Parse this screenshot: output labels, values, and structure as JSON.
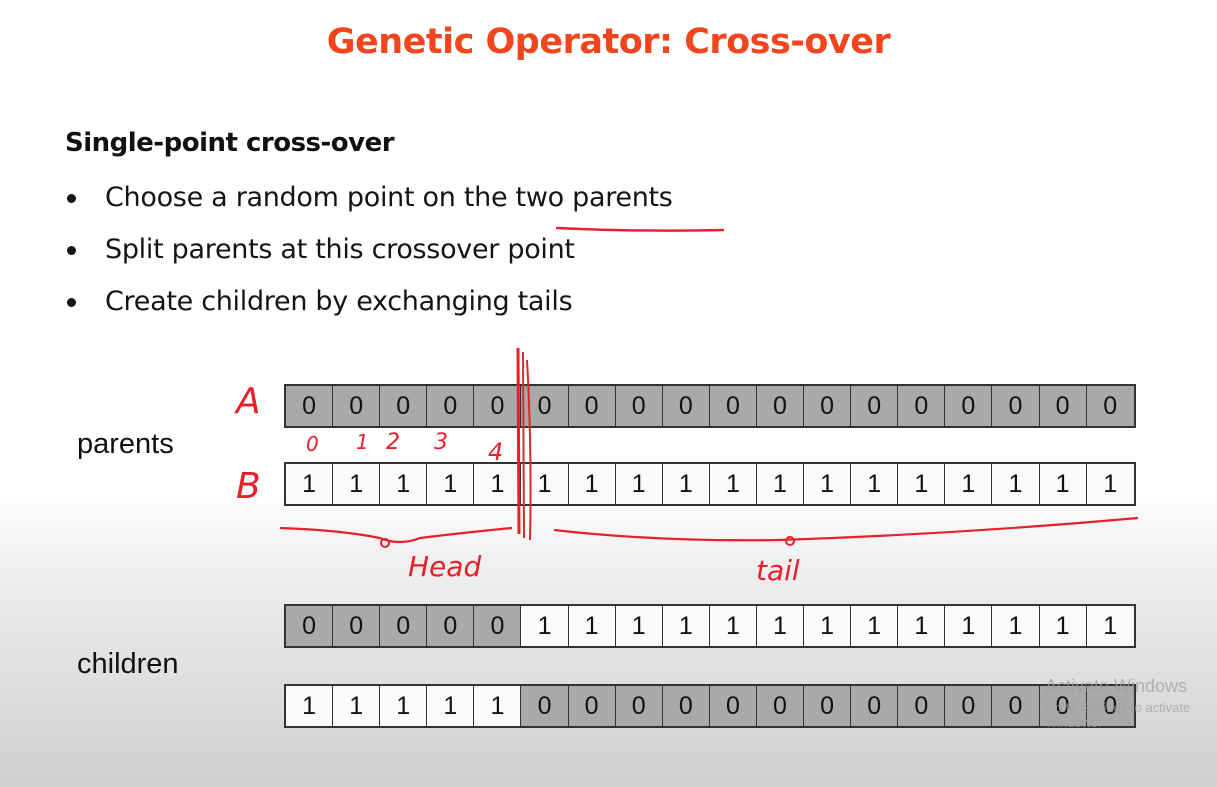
{
  "title": "Genetic Operator: Cross-over",
  "subtitle": "Single-point cross-over",
  "bullets": [
    "Choose a random point on the two parents",
    "Split parents at this crossover point",
    "Create children by exchanging tails"
  ],
  "labels": {
    "parents": "parents",
    "children": "children"
  },
  "strips": {
    "parent_a": [
      "0",
      "0",
      "0",
      "0",
      "0",
      "0",
      "0",
      "0",
      "0",
      "0",
      "0",
      "0",
      "0",
      "0",
      "0",
      "0",
      "0",
      "0"
    ],
    "parent_b": [
      "1",
      "1",
      "1",
      "1",
      "1",
      "1",
      "1",
      "1",
      "1",
      "1",
      "1",
      "1",
      "1",
      "1",
      "1",
      "1",
      "1",
      "1"
    ],
    "child_1": [
      "0",
      "0",
      "0",
      "0",
      "0",
      "1",
      "1",
      "1",
      "1",
      "1",
      "1",
      "1",
      "1",
      "1",
      "1",
      "1",
      "1",
      "1"
    ],
    "child_2": [
      "1",
      "1",
      "1",
      "1",
      "1",
      "0",
      "0",
      "0",
      "0",
      "0",
      "0",
      "0",
      "0",
      "0",
      "0",
      "0",
      "0",
      "0"
    ]
  },
  "annotations": {
    "letter_a": "A",
    "letter_b": "B",
    "indices": [
      "0",
      "1",
      "2",
      "3",
      "4"
    ],
    "head": "Head",
    "tail": "tail"
  },
  "watermark": {
    "line1": "Activate Windows",
    "line2": "Go to Settings to activate Windows."
  },
  "colors": {
    "title": "#f0451d",
    "ink": "#e8202a",
    "dark_cell": "#a9a9a9",
    "light_cell": "#fafafa"
  }
}
